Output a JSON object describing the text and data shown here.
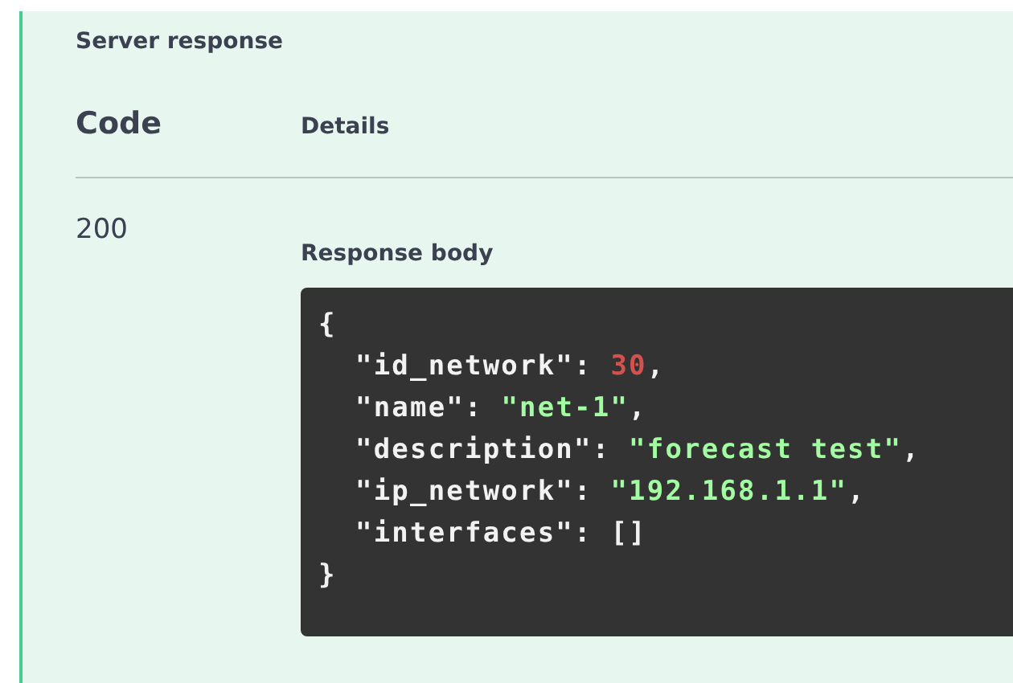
{
  "section_title": "Server response",
  "table": {
    "columns": [
      "Code",
      "Details"
    ],
    "rows": [
      {
        "code": "200",
        "details_title": "Response body",
        "body_lines": [
          {
            "kind": "brace",
            "tokens": [
              {
                "kind": "punct",
                "text": "{"
              }
            ]
          },
          {
            "kind": "member",
            "tokens": [
              {
                "kind": "key",
                "text": "\"id_network\""
              },
              {
                "kind": "punct",
                "text": ": "
              },
              {
                "kind": "number",
                "text": "30"
              },
              {
                "kind": "punct",
                "text": ","
              }
            ]
          },
          {
            "kind": "member",
            "tokens": [
              {
                "kind": "key",
                "text": "\"name\""
              },
              {
                "kind": "punct",
                "text": ": "
              },
              {
                "kind": "string",
                "text": "\"net-1\""
              },
              {
                "kind": "punct",
                "text": ","
              }
            ]
          },
          {
            "kind": "member",
            "tokens": [
              {
                "kind": "key",
                "text": "\"description\""
              },
              {
                "kind": "punct",
                "text": ": "
              },
              {
                "kind": "string",
                "text": "\"forecast test\""
              },
              {
                "kind": "punct",
                "text": ","
              }
            ]
          },
          {
            "kind": "member",
            "tokens": [
              {
                "kind": "key",
                "text": "\"ip_network\""
              },
              {
                "kind": "punct",
                "text": ": "
              },
              {
                "kind": "string",
                "text": "\"192.168.1.1\""
              },
              {
                "kind": "punct",
                "text": ","
              }
            ]
          },
          {
            "kind": "member",
            "tokens": [
              {
                "kind": "key",
                "text": "\"interfaces\""
              },
              {
                "kind": "punct",
                "text": ": []"
              }
            ]
          },
          {
            "kind": "brace",
            "tokens": [
              {
                "kind": "punct",
                "text": "}"
              }
            ]
          }
        ]
      }
    ]
  }
}
